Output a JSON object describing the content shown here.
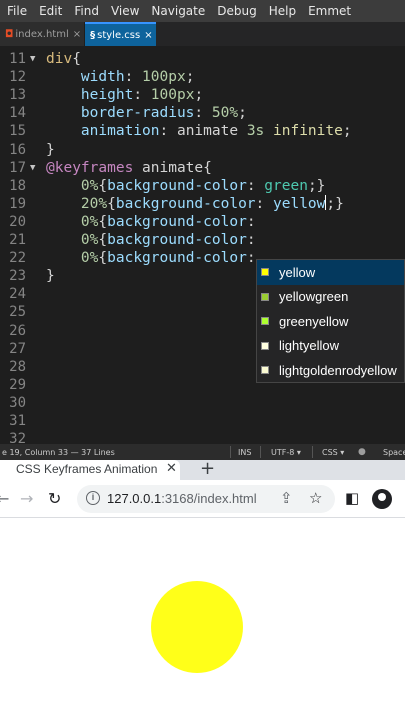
{
  "menu": [
    "File",
    "Edit",
    "Find",
    "View",
    "Navigate",
    "Debug",
    "Help",
    "Emmet"
  ],
  "tabs": [
    {
      "label": "index.html",
      "icon": "html5-icon",
      "active": false
    },
    {
      "label": "style.css",
      "icon": "css3-icon",
      "active": true
    }
  ],
  "code_lines": [
    {
      "n": "11",
      "fold": "▼",
      "tokens": [
        [
          "tk-sel",
          "div"
        ],
        [
          "tk-punc",
          "{"
        ]
      ]
    },
    {
      "n": "12",
      "fold": "",
      "tokens": [
        [
          "tk-word",
          "    "
        ],
        [
          "tk-prop",
          "width"
        ],
        [
          "tk-punc",
          ": "
        ],
        [
          "tk-num",
          "100px"
        ],
        [
          "tk-punc",
          ";"
        ]
      ]
    },
    {
      "n": "13",
      "fold": "",
      "tokens": [
        [
          "tk-word",
          "    "
        ],
        [
          "tk-prop",
          "height"
        ],
        [
          "tk-punc",
          ": "
        ],
        [
          "tk-num",
          "100px"
        ],
        [
          "tk-punc",
          ";"
        ]
      ]
    },
    {
      "n": "14",
      "fold": "",
      "tokens": [
        [
          "tk-word",
          "    "
        ],
        [
          "tk-prop",
          "border-radius"
        ],
        [
          "tk-punc",
          ": "
        ],
        [
          "tk-num",
          "50%"
        ],
        [
          "tk-punc",
          ";"
        ]
      ]
    },
    {
      "n": "15",
      "fold": "",
      "tokens": [
        [
          "tk-word",
          "    "
        ],
        [
          "tk-prop",
          "animation"
        ],
        [
          "tk-punc",
          ": "
        ],
        [
          "tk-word",
          "animate "
        ],
        [
          "tk-time",
          "3s "
        ],
        [
          "tk-inf",
          "infinite"
        ],
        [
          "tk-punc",
          ";"
        ]
      ]
    },
    {
      "n": "16",
      "fold": "",
      "tokens": [
        [
          "tk-punc",
          "}"
        ]
      ]
    },
    {
      "n": "17",
      "fold": "▼",
      "tokens": [
        [
          "tk-kw",
          "@keyframes "
        ],
        [
          "tk-word",
          "animate"
        ],
        [
          "tk-punc",
          "{"
        ]
      ]
    },
    {
      "n": "18",
      "fold": "",
      "tokens": [
        [
          "tk-word",
          "    "
        ],
        [
          "tk-num",
          "0%"
        ],
        [
          "tk-punc",
          "{"
        ],
        [
          "tk-prop",
          "background-color"
        ],
        [
          "tk-punc",
          ": "
        ],
        [
          "tk-green",
          "green"
        ],
        [
          "tk-punc",
          ";}"
        ]
      ]
    },
    {
      "n": "19",
      "fold": "",
      "tokens": [
        [
          "tk-word",
          "    "
        ],
        [
          "tk-num",
          "20%"
        ],
        [
          "tk-punc",
          "{"
        ],
        [
          "tk-prop",
          "background-color"
        ],
        [
          "tk-punc",
          ": "
        ],
        [
          "tk-ylw",
          "yellow"
        ],
        [
          "caret",
          ""
        ],
        [
          "tk-punc",
          ";}"
        ]
      ]
    },
    {
      "n": "20",
      "fold": "",
      "tokens": [
        [
          "tk-word",
          "    "
        ],
        [
          "tk-num",
          "0%"
        ],
        [
          "tk-punc",
          "{"
        ],
        [
          "tk-prop",
          "background-color"
        ],
        [
          "tk-punc",
          ":"
        ]
      ]
    },
    {
      "n": "21",
      "fold": "",
      "tokens": [
        [
          "tk-word",
          "    "
        ],
        [
          "tk-num",
          "0%"
        ],
        [
          "tk-punc",
          "{"
        ],
        [
          "tk-prop",
          "background-color"
        ],
        [
          "tk-punc",
          ":"
        ]
      ]
    },
    {
      "n": "22",
      "fold": "",
      "tokens": [
        [
          "tk-word",
          "    "
        ],
        [
          "tk-num",
          "0%"
        ],
        [
          "tk-punc",
          "{"
        ],
        [
          "tk-prop",
          "background-color"
        ],
        [
          "tk-punc",
          ":"
        ]
      ]
    },
    {
      "n": "23",
      "fold": "",
      "tokens": [
        [
          "tk-punc",
          "}"
        ]
      ]
    },
    {
      "n": "24",
      "fold": "",
      "tokens": []
    },
    {
      "n": "25",
      "fold": "",
      "tokens": []
    },
    {
      "n": "26",
      "fold": "",
      "tokens": []
    },
    {
      "n": "27",
      "fold": "",
      "tokens": []
    },
    {
      "n": "28",
      "fold": "",
      "tokens": []
    },
    {
      "n": "29",
      "fold": "",
      "tokens": []
    },
    {
      "n": "30",
      "fold": "",
      "tokens": []
    },
    {
      "n": "31",
      "fold": "",
      "tokens": []
    },
    {
      "n": "32",
      "fold": "",
      "tokens": []
    }
  ],
  "autocomplete": [
    {
      "label": "yellow",
      "color": "#ffff00",
      "selected": true
    },
    {
      "label": "yellowgreen",
      "color": "#9acd32",
      "selected": false
    },
    {
      "label": "greenyellow",
      "color": "#adff2f",
      "selected": false
    },
    {
      "label": "lightyellow",
      "color": "#ffffe0",
      "selected": false
    },
    {
      "label": "lightgoldenrodyellow",
      "color": "#fafad2",
      "selected": false
    }
  ],
  "status": {
    "cursor": "e 19, Column 33 — 37 Lines",
    "ins": "INS",
    "encoding": "UTF-8 ▾",
    "language": "CSS ▾",
    "spaces": "Spaces"
  },
  "browser": {
    "tab_title": "CSS Keyframes Animation",
    "url_host": "127.0.0.1",
    "url_path": ":3168/index.html"
  },
  "colors": {
    "circle": "#ffff19",
    "accent": "#0e639c"
  }
}
